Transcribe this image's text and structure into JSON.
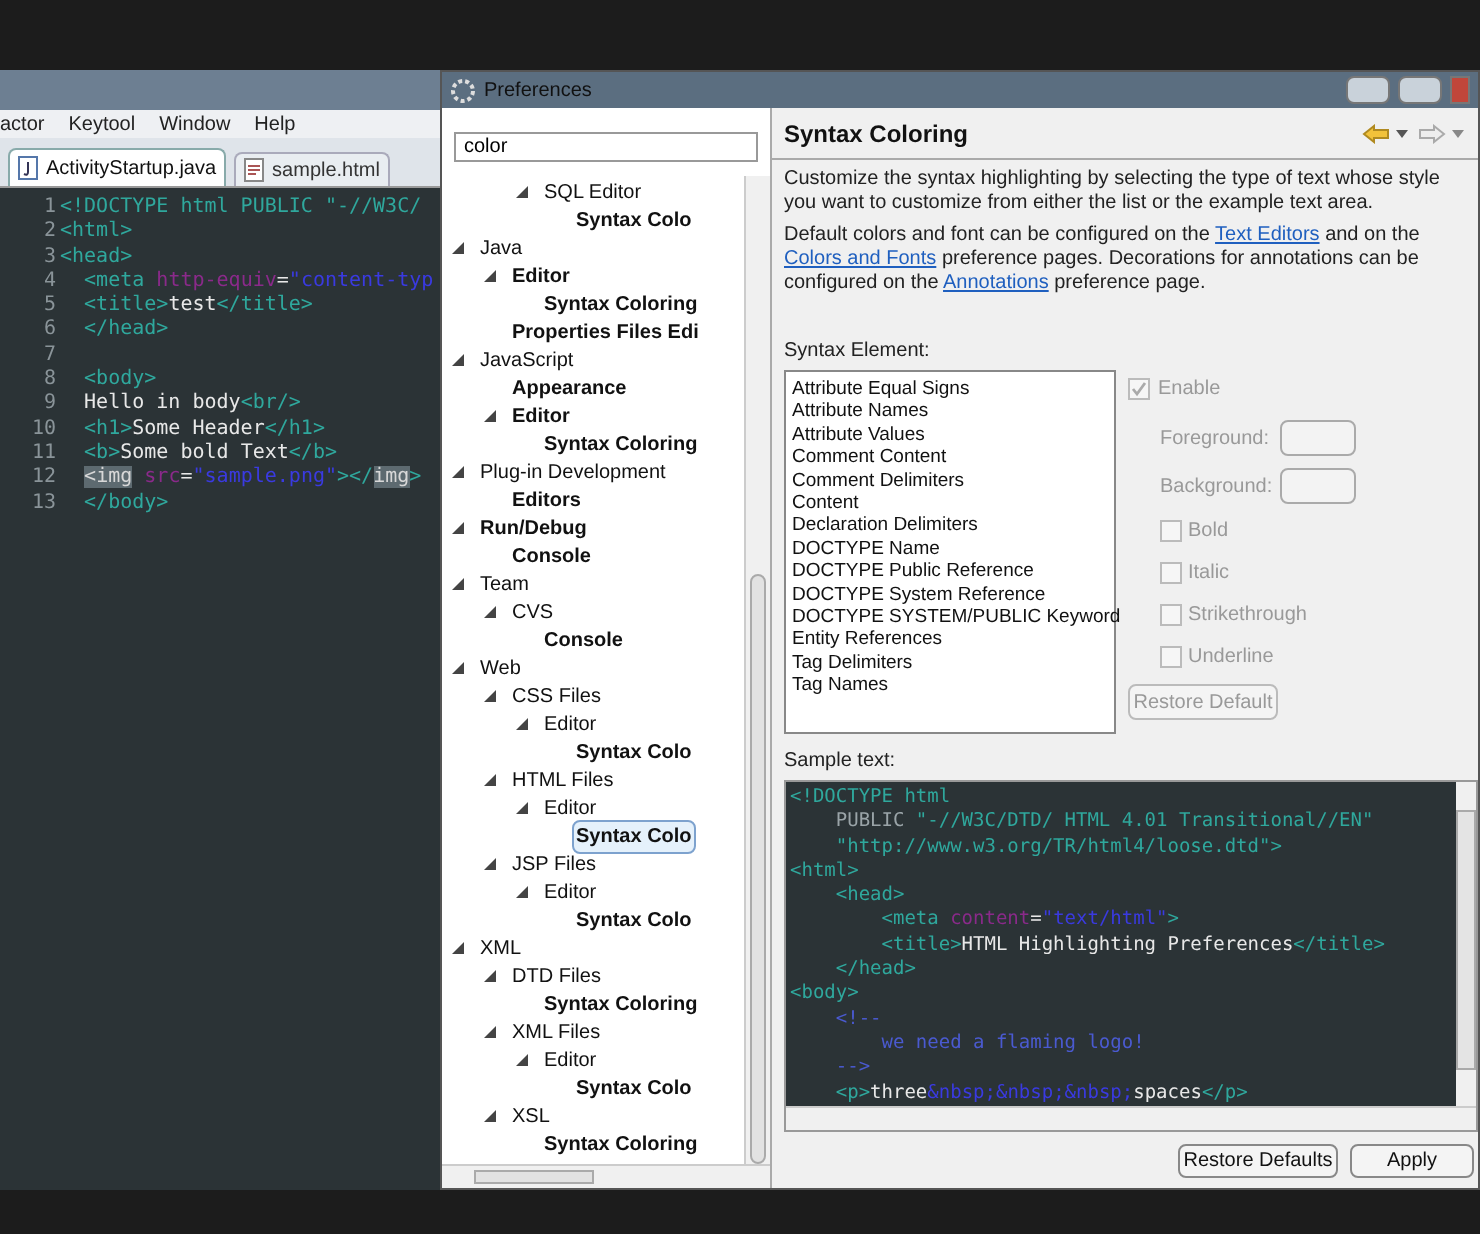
{
  "menu_bar": [
    "actor",
    "Keytool",
    "Window",
    "Help"
  ],
  "editor_tabs": [
    {
      "label": "ActivityStartup.java",
      "selected": true,
      "kind": "java"
    },
    {
      "label": "sample.html",
      "selected": false,
      "kind": "html"
    }
  ],
  "editor_lines": [
    {
      "number": "1",
      "tokens": [
        {
          "kind": "tag",
          "text": "<!DOCTYPE html PUBLIC \"-//W3C/"
        }
      ]
    },
    {
      "number": "2",
      "tokens": [
        {
          "kind": "tag",
          "text": "<html>"
        }
      ]
    },
    {
      "number": "3",
      "tokens": [
        {
          "kind": "tag",
          "text": "<head>"
        }
      ]
    },
    {
      "number": "4",
      "tokens": [
        {
          "kind": "tag",
          "text": "  <meta "
        },
        {
          "kind": "attr",
          "text": "http-equiv"
        },
        {
          "kind": "text",
          "text": "="
        },
        {
          "kind": "value",
          "text": "\"content-typ"
        }
      ]
    },
    {
      "number": "5",
      "tokens": [
        {
          "kind": "tag",
          "text": "  <title>"
        },
        {
          "kind": "text",
          "text": "test"
        },
        {
          "kind": "tag",
          "text": "</title>"
        }
      ]
    },
    {
      "number": "6",
      "tokens": [
        {
          "kind": "tag",
          "text": "  </head>"
        }
      ]
    },
    {
      "number": "7"
    },
    {
      "number": "8",
      "tokens": [
        {
          "kind": "tag",
          "text": "  <body>"
        }
      ]
    },
    {
      "number": "9",
      "tokens": [
        {
          "kind": "text",
          "text": "  Hello in body"
        },
        {
          "kind": "tag",
          "text": "<br/>"
        }
      ]
    },
    {
      "number": "10",
      "tokens": [
        {
          "kind": "tag",
          "text": "  <h1>"
        },
        {
          "kind": "text",
          "text": "Some Header"
        },
        {
          "kind": "tag",
          "text": "</h1>"
        }
      ]
    },
    {
      "number": "11",
      "tokens": [
        {
          "kind": "tag",
          "text": "  <b>"
        },
        {
          "kind": "text",
          "text": "Some bold Text"
        },
        {
          "kind": "tag",
          "text": "</b>"
        }
      ]
    },
    {
      "number": "12",
      "tokens": [
        {
          "kind": "mark",
          "text": "  <img"
        },
        {
          "kind": "attr",
          "text": " src"
        },
        {
          "kind": "text",
          "text": "="
        },
        {
          "kind": "value",
          "text": "\"sample.png\""
        },
        {
          "kind": "tag",
          "text": "></"
        },
        {
          "kind": "mark",
          "text": "img"
        },
        {
          "kind": "tag",
          "text": ">"
        }
      ]
    },
    {
      "number": "13",
      "tokens": [
        {
          "kind": "tag",
          "text": "  </body>"
        }
      ]
    }
  ],
  "preferences": {
    "title": "Preferences",
    "filter": {
      "value": "color"
    },
    "tree": [
      {
        "children": [
          {
            "children": [
              {
                "label": "SQL Editor",
                "bold": false,
                "selected": false,
                "expanded": true,
                "children": [
                  {
                    "label": "Syntax Colo",
                    "bold": true,
                    "selected": false
                  }
                ]
              }
            ]
          }
        ]
      },
      {
        "label": "Java",
        "bold": false,
        "selected": false,
        "expanded": true,
        "children": [
          {
            "label": "Editor",
            "bold": true,
            "selected": false,
            "expanded": true,
            "children": [
              {
                "label": "Syntax Coloring",
                "bold": true,
                "selected": false
              }
            ]
          },
          {
            "label": "Properties Files Edi",
            "bold": true,
            "selected": false
          }
        ]
      },
      {
        "label": "JavaScript",
        "bold": false,
        "selected": false,
        "expanded": true,
        "children": [
          {
            "label": "Appearance",
            "bold": true,
            "selected": false
          },
          {
            "label": "Editor",
            "bold": true,
            "selected": false,
            "expanded": true,
            "children": [
              {
                "label": "Syntax Coloring",
                "bold": true,
                "selected": false
              }
            ]
          }
        ]
      },
      {
        "label": "Plug-in Development",
        "bold": false,
        "selected": false,
        "expanded": true,
        "children": [
          {
            "label": "Editors",
            "bold": true,
            "selected": false
          }
        ]
      },
      {
        "label": "Run/Debug",
        "bold": true,
        "selected": false,
        "expanded": true,
        "children": [
          {
            "label": "Console",
            "bold": true,
            "selected": false
          }
        ]
      },
      {
        "label": "Team",
        "bold": false,
        "selected": false,
        "expanded": true,
        "children": [
          {
            "label": "CVS",
            "bold": false,
            "selected": false,
            "expanded": true,
            "children": [
              {
                "label": "Console",
                "bold": true,
                "selected": false
              }
            ]
          }
        ]
      },
      {
        "label": "Web",
        "bold": false,
        "selected": false,
        "expanded": true,
        "children": [
          {
            "label": "CSS Files",
            "bold": false,
            "selected": false,
            "expanded": true,
            "children": [
              {
                "label": "Editor",
                "bold": false,
                "selected": false,
                "expanded": true,
                "children": [
                  {
                    "label": "Syntax Colo",
                    "bold": true,
                    "selected": false
                  }
                ]
              }
            ]
          },
          {
            "label": "HTML Files",
            "bold": false,
            "selected": false,
            "expanded": true,
            "children": [
              {
                "label": "Editor",
                "bold": false,
                "selected": false,
                "expanded": true,
                "children": [
                  {
                    "label": "Syntax Colo",
                    "bold": true,
                    "selected": true
                  }
                ]
              }
            ]
          },
          {
            "label": "JSP Files",
            "bold": false,
            "selected": false,
            "expanded": true,
            "children": [
              {
                "label": "Editor",
                "bold": false,
                "selected": false,
                "expanded": true,
                "children": [
                  {
                    "label": "Syntax Colo",
                    "bold": true,
                    "selected": false
                  }
                ]
              }
            ]
          }
        ]
      },
      {
        "label": "XML",
        "bold": false,
        "selected": false,
        "expanded": true,
        "children": [
          {
            "label": "DTD Files",
            "bold": false,
            "selected": false,
            "expanded": true,
            "children": [
              {
                "label": "Syntax Coloring",
                "bold": true,
                "selected": false
              }
            ]
          },
          {
            "label": "XML Files",
            "bold": false,
            "selected": false,
            "expanded": true,
            "children": [
              {
                "label": "Editor",
                "bold": false,
                "selected": false,
                "expanded": true,
                "children": [
                  {
                    "label": "Syntax Colo",
                    "bold": true,
                    "selected": false
                  }
                ]
              }
            ]
          },
          {
            "label": "XSL",
            "bold": false,
            "selected": false,
            "expanded": true,
            "children": [
              {
                "label": "Syntax Coloring",
                "bold": true,
                "selected": false
              }
            ]
          }
        ]
      }
    ],
    "page_title": "Syntax Coloring",
    "description": "Customize the syntax highlighting by selecting the type of text whose style you want to customize from either the list or the example text area.",
    "defaults_note": [
      {
        "kind": "text",
        "text": "Default colors and font can be configured on the"
      },
      {
        "kind": "link",
        "text": "Text Editors"
      },
      {
        "kind": "text",
        "text": "and on the"
      },
      {
        "kind": "link",
        "text": "Colors and Fonts"
      },
      {
        "kind": "text",
        "text": "preference pages.  Decorations for annotations can be configured on the"
      },
      {
        "kind": "link",
        "text": "Annotations"
      },
      {
        "kind": "text",
        "text": "preference page."
      }
    ],
    "syntax_element_label": "Syntax Element:",
    "syntax_elements": [
      "Attribute Equal Signs",
      "Attribute Names",
      "Attribute Values",
      "Comment Content",
      "Comment Delimiters",
      "Content",
      "Declaration Delimiters",
      "DOCTYPE Name",
      "DOCTYPE Public Reference",
      "DOCTYPE System Reference",
      "DOCTYPE SYSTEM/PUBLIC Keyword",
      "Entity References",
      "Tag Delimiters",
      "Tag Names"
    ],
    "enable": {
      "label": "Enable",
      "checked": true,
      "disabled": true
    },
    "foreground_label": "Foreground:",
    "background_label": "Background:",
    "styles": [
      {
        "label": "Bold",
        "checked": false
      },
      {
        "label": "Italic",
        "checked": false
      },
      {
        "label": "Strikethrough",
        "checked": false
      },
      {
        "label": "Underline",
        "checked": false
      }
    ],
    "restore_default": "Restore Default",
    "sample_label": "Sample text:",
    "sample_lines": [
      [
        {
          "kind": "tag",
          "text": "<!DOCTYPE html"
        }
      ],
      [
        {
          "kind": "doctype",
          "text": "    PUBLIC "
        },
        {
          "kind": "tag",
          "text": "\"-//W3C/DTD/ HTML 4.01 Transitional//EN\""
        }
      ],
      [
        {
          "kind": "tag",
          "text": "    \"http://www.w3.org/TR/html4/loose.dtd\">"
        }
      ],
      [
        {
          "kind": "tag",
          "text": "<html>"
        }
      ],
      [
        {
          "kind": "tag",
          "text": "    <head>"
        }
      ],
      [
        {
          "kind": "tag",
          "text": "        <meta "
        },
        {
          "kind": "attr",
          "text": "content"
        },
        {
          "kind": "text",
          "text": "="
        },
        {
          "kind": "value",
          "text": "\"text/html\""
        },
        {
          "kind": "tag",
          "text": ">"
        }
      ],
      [
        {
          "kind": "tag",
          "text": "        <title>"
        },
        {
          "kind": "text",
          "text": "HTML Highlighting Preferences"
        },
        {
          "kind": "tag",
          "text": "</title>"
        }
      ],
      [
        {
          "kind": "tag",
          "text": "    </head>"
        }
      ],
      [
        {
          "kind": "tag",
          "text": "<body>"
        }
      ],
      [
        {
          "kind": "comment",
          "text": "    <!--"
        }
      ],
      [
        {
          "kind": "comment",
          "text": "        we need a flaming logo!"
        }
      ],
      [
        {
          "kind": "comment",
          "text": "    -->"
        }
      ],
      [
        {
          "kind": "tag",
          "text": "    <p>"
        },
        {
          "kind": "text",
          "text": "three"
        },
        {
          "kind": "value",
          "text": "&nbsp;&nbsp;&nbsp;"
        },
        {
          "kind": "text",
          "text": "spaces"
        },
        {
          "kind": "tag",
          "text": "</p>"
        }
      ]
    ],
    "buttons": [
      "Restore Defaults",
      "Apply"
    ]
  }
}
